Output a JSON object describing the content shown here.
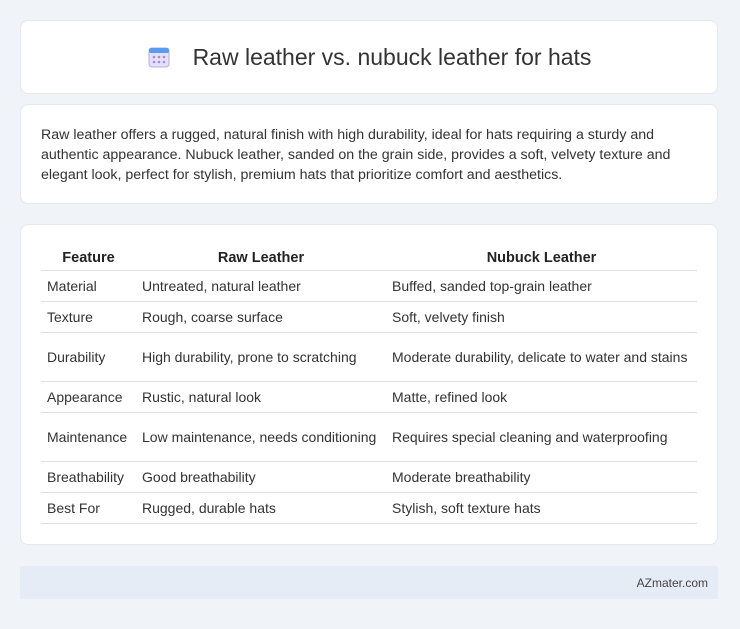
{
  "header": {
    "title": "Raw leather vs. nubuck leather for hats",
    "icon": "calendar-icon"
  },
  "intro": {
    "text": "Raw leather offers a rugged, natural finish with high durability, ideal for hats requiring a sturdy and authentic appearance. Nubuck leather, sanded on the grain side, provides a soft, velvety texture and elegant look, perfect for stylish, premium hats that prioritize comfort and aesthetics."
  },
  "table": {
    "headers": [
      "Feature",
      "Raw Leather",
      "Nubuck Leather"
    ],
    "rows": [
      [
        "Material",
        "Untreated, natural leather",
        "Buffed, sanded top-grain leather"
      ],
      [
        "Texture",
        "Rough, coarse surface",
        "Soft, velvety finish"
      ],
      [
        "Durability",
        "High durability, prone to scratching",
        "Moderate durability, delicate to water and stains"
      ],
      [
        "Appearance",
        "Rustic, natural look",
        "Matte, refined look"
      ],
      [
        "Maintenance",
        "Low maintenance, needs conditioning",
        "Requires special cleaning and waterproofing"
      ],
      [
        "Breathability",
        "Good breathability",
        "Moderate breathability"
      ],
      [
        "Best For",
        "Rugged, durable hats",
        "Stylish, soft texture hats"
      ]
    ]
  },
  "footer": {
    "brand": "AZmater.com"
  }
}
